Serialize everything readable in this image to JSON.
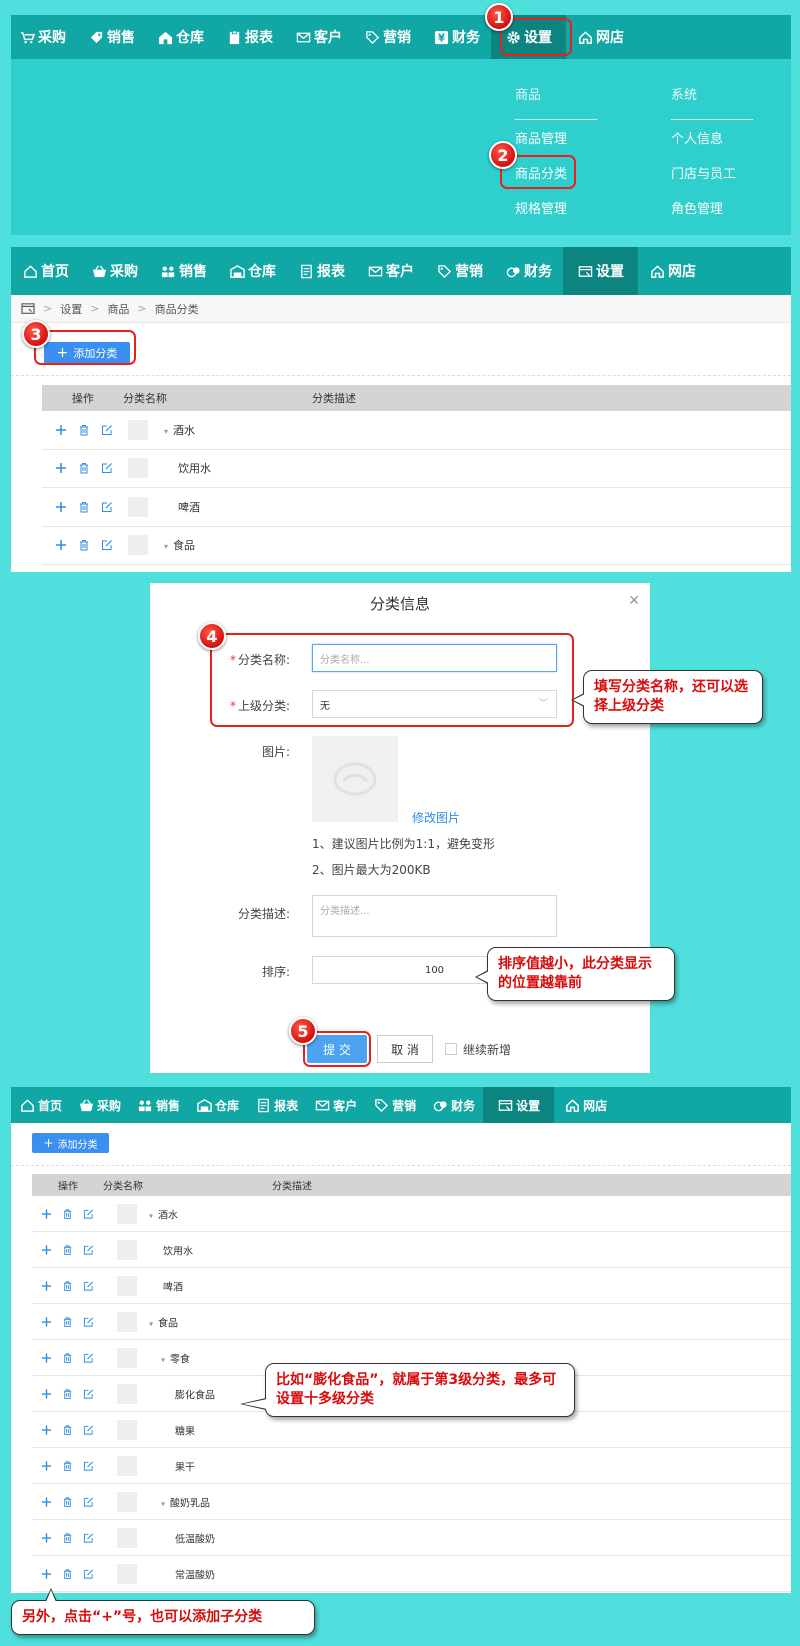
{
  "nav1": {
    "items": [
      {
        "label": "采购",
        "icon": "cart-icon"
      },
      {
        "label": "销售",
        "icon": "tag-icon"
      },
      {
        "label": "仓库",
        "icon": "home-icon"
      },
      {
        "label": "报表",
        "icon": "clipboard-icon"
      },
      {
        "label": "客户",
        "icon": "mail-icon"
      },
      {
        "label": "营销",
        "icon": "price-tag-icon"
      },
      {
        "label": "财务",
        "icon": "yen-icon"
      },
      {
        "label": "设置",
        "icon": "gear-icon"
      },
      {
        "label": "网店",
        "icon": "house-outline-icon"
      }
    ]
  },
  "dropdown": {
    "goods_head": "商品",
    "system_head": "系统",
    "goods_items": [
      "商品管理",
      "商品分类",
      "规格管理"
    ],
    "system_items": [
      "个人信息",
      "门店与员工",
      "角色管理"
    ]
  },
  "nav2": {
    "items": [
      "首页",
      "采购",
      "销售",
      "仓库",
      "报表",
      "客户",
      "营销",
      "财务",
      "设置",
      "网店"
    ]
  },
  "breadcrumb": {
    "items": [
      "设置",
      "商品",
      "商品分类"
    ]
  },
  "add_button": "添加分类",
  "table": {
    "col_ops": "操作",
    "col_name": "分类名称",
    "col_desc": "分类描述"
  },
  "list1": [
    "酒水",
    "饮用水",
    "啤酒",
    "食品"
  ],
  "dialog": {
    "title": "分类信息",
    "name_label": "分类名称:",
    "name_placeholder": "分类名称...",
    "parent_label": "上级分类:",
    "parent_value": "无",
    "image_label": "图片:",
    "change_image": "修改图片",
    "note1": "1、建议图片比例为1:1，避免变形",
    "note2": "2、图片最大为200KB",
    "desc_label": "分类描述:",
    "desc_placeholder": "分类描述...",
    "sort_label": "排序:",
    "sort_value": "100",
    "submit": "提 交",
    "cancel": "取 消",
    "continue": "继续新增"
  },
  "list2": [
    "酒水",
    "饮用水",
    "啤酒",
    "食品",
    "零食",
    "膨化食品",
    "糖果",
    "果干",
    "酸奶乳品",
    "低温酸奶",
    "常温酸奶"
  ],
  "callouts": {
    "c1": "填写分类名称，还可以选择上级分类",
    "c2": "排序值越小，此分类显示的位置越靠前",
    "c3": "比如“膨化食品”，就属于第3级分类，最多可设置十多级分类",
    "c4": "另外，点击“+”号，也可以添加子分类"
  },
  "markers": [
    "1",
    "2",
    "3",
    "4",
    "5"
  ],
  "colors": {
    "nav": "#10a7a4",
    "nav_active": "#0c8480",
    "background": "#4fe0de",
    "accent": "#3b8ff0",
    "annotation_red": "#e5231e"
  }
}
